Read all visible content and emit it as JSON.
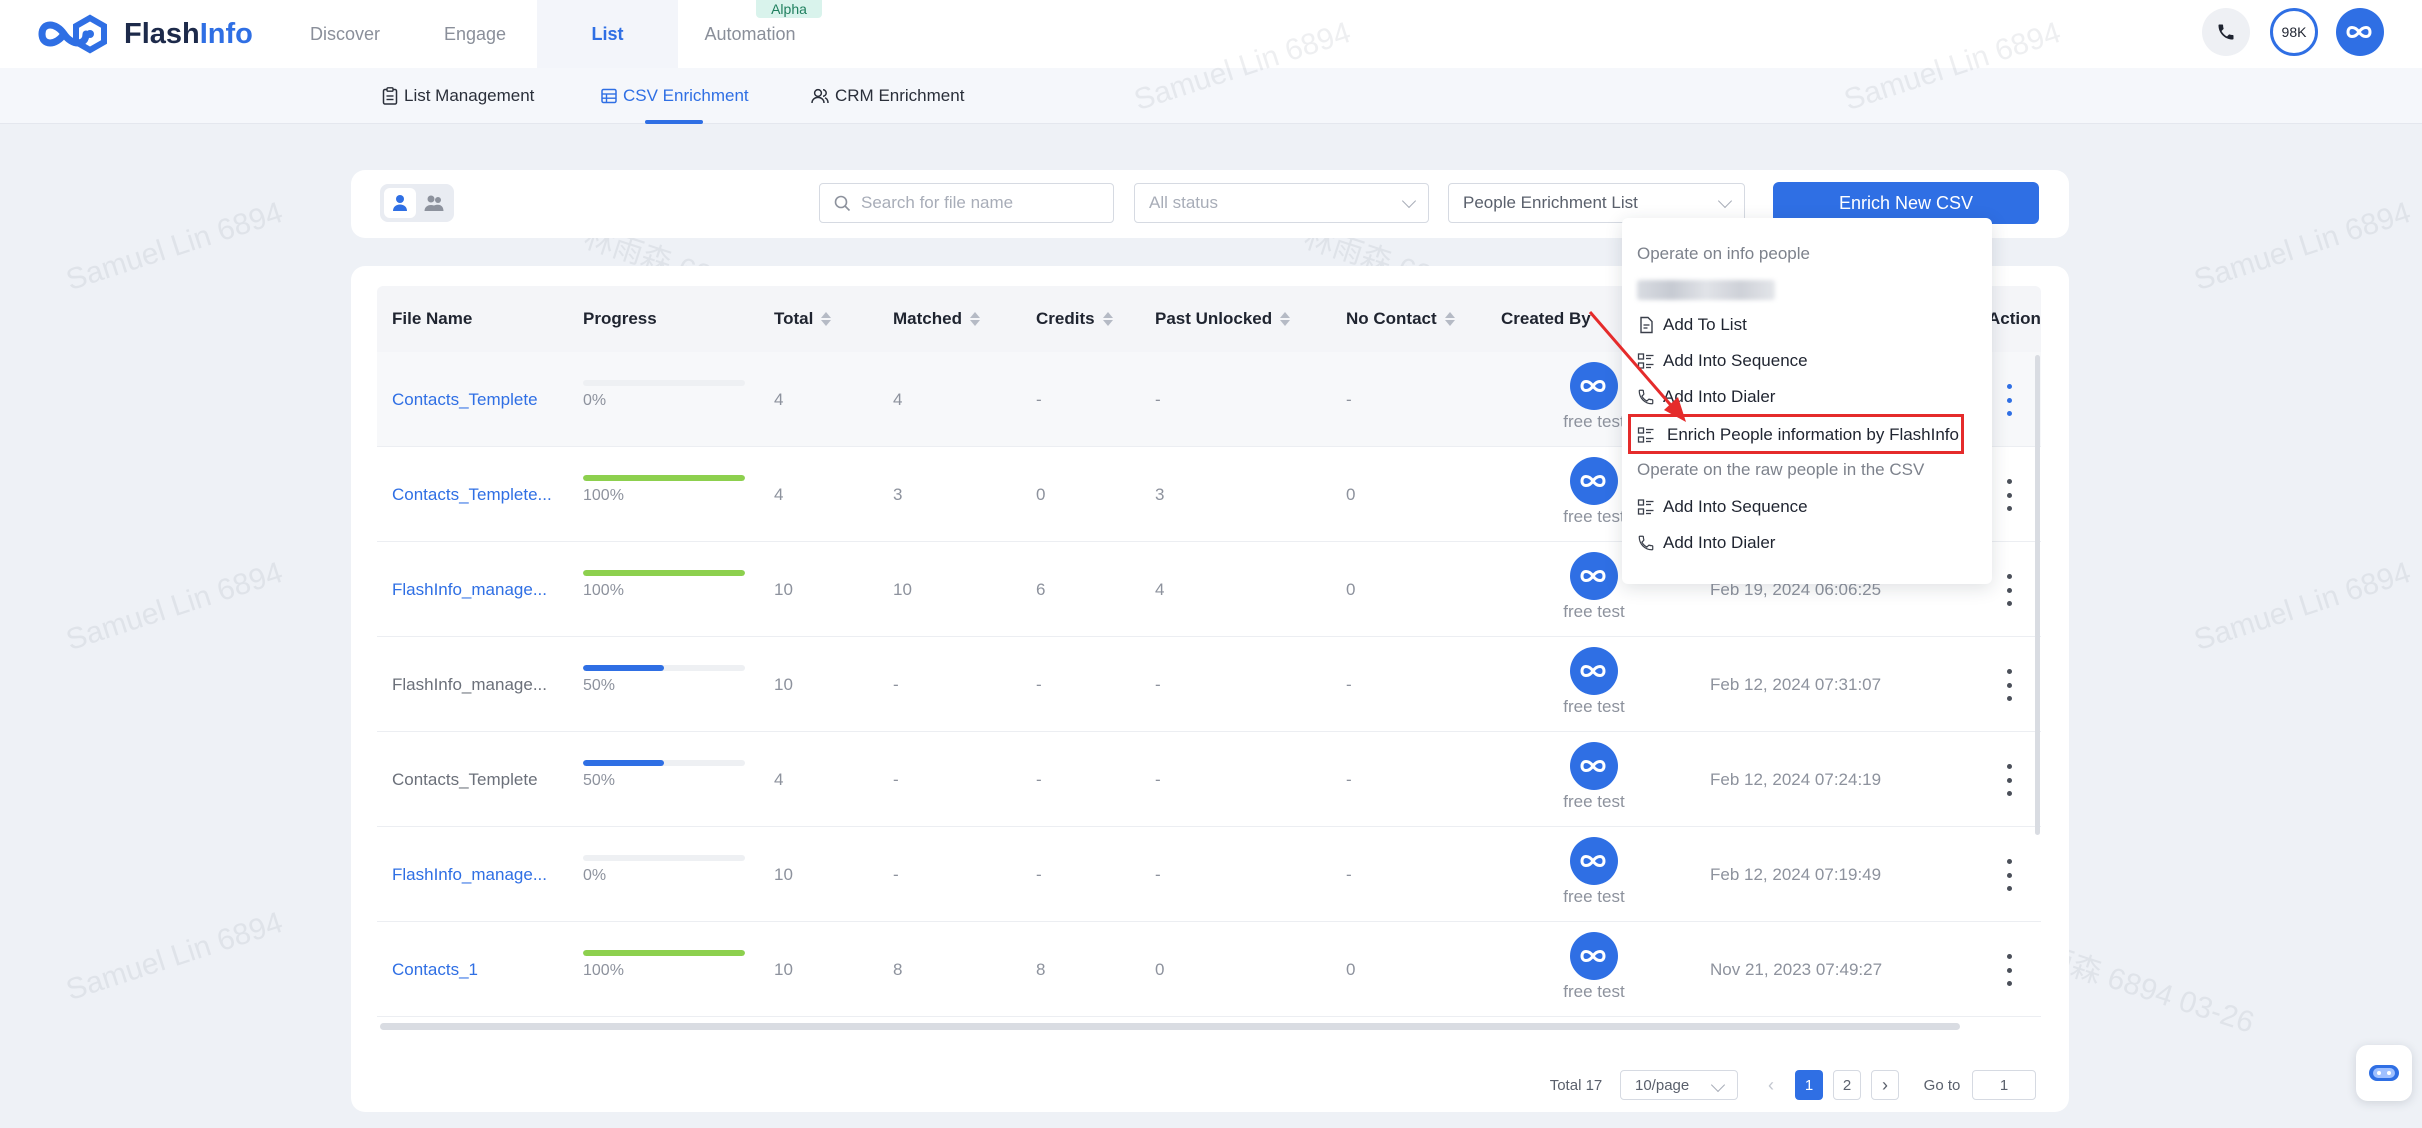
{
  "brand": {
    "name_part1": "Flash",
    "name_part2": "Info",
    "accent": "#2f6fe4"
  },
  "nav": {
    "tabs": [
      {
        "label": "Discover"
      },
      {
        "label": "Engage"
      },
      {
        "label": "List"
      },
      {
        "label": "Automation"
      }
    ],
    "badge": "Alpha",
    "credits": "98K",
    "phone_icon": "phone-icon",
    "profile_icon": "flashinfo-logo-icon"
  },
  "subnav": {
    "tabs": [
      {
        "label": "List Management",
        "icon": "clipboard-icon"
      },
      {
        "label": "CSV Enrichment",
        "icon": "table-icon"
      },
      {
        "label": "CRM Enrichment",
        "icon": "users-icon"
      }
    ]
  },
  "toolbar": {
    "search_placeholder": "Search for file name",
    "status_placeholder": "All status",
    "list_type": "People Enrichment List",
    "enrich_button": "Enrich New CSV"
  },
  "table": {
    "headers": {
      "file_name": "File Name",
      "progress": "Progress",
      "total": "Total",
      "matched": "Matched",
      "credits": "Credits",
      "past_unlocked": "Past Unlocked",
      "no_contact": "No Contact",
      "created_by": "Created By",
      "action": "Action"
    },
    "rows": [
      {
        "file": "Contacts_Templete",
        "progress": "0%",
        "progress_value": 0,
        "total": "4",
        "matched": "4",
        "credits": "-",
        "past": "-",
        "nocontact": "-",
        "creator": "free test",
        "date": ""
      },
      {
        "file": "Contacts_Templete...",
        "progress": "100%",
        "progress_value": 100,
        "total": "4",
        "matched": "3",
        "credits": "0",
        "past": "3",
        "nocontact": "0",
        "creator": "free test",
        "date": ""
      },
      {
        "file": "FlashInfo_manage...",
        "progress": "100%",
        "progress_value": 100,
        "total": "10",
        "matched": "10",
        "credits": "6",
        "past": "4",
        "nocontact": "0",
        "creator": "free test",
        "date": "Feb 19, 2024 06:06:25"
      },
      {
        "file": "FlashInfo_manage...",
        "progress": "50%",
        "progress_value": 50,
        "total": "10",
        "matched": "-",
        "credits": "-",
        "past": "-",
        "nocontact": "-",
        "creator": "free test",
        "date": "Feb 12, 2024 07:31:07"
      },
      {
        "file": "Contacts_Templete",
        "progress": "50%",
        "progress_value": 50,
        "total": "4",
        "matched": "-",
        "credits": "-",
        "past": "-",
        "nocontact": "-",
        "creator": "free test",
        "date": "Feb 12, 2024 07:24:19"
      },
      {
        "file": "FlashInfo_manage...",
        "progress": "0%",
        "progress_value": 0,
        "total": "10",
        "matched": "-",
        "credits": "-",
        "past": "-",
        "nocontact": "-",
        "creator": "free test",
        "date": "Feb 12, 2024 07:19:49"
      },
      {
        "file": "Contacts_1",
        "progress": "100%",
        "progress_value": 100,
        "total": "10",
        "matched": "8",
        "credits": "8",
        "past": "0",
        "nocontact": "0",
        "creator": "free test",
        "date": "Nov 21, 2023 07:49:27"
      }
    ]
  },
  "colors": {
    "green": "#8dd04e",
    "blue": "#2f6fe4",
    "highlight": "#e52b2b"
  },
  "pagination": {
    "total": "Total 17",
    "page_size": "10/page",
    "pages": [
      "1",
      "2"
    ],
    "goto_label": "Go to",
    "goto_value": "1"
  },
  "menu": {
    "header1": "Operate on info people",
    "items1": [
      {
        "label": "Add To List",
        "icon": "document-icon"
      },
      {
        "label": "Add Into Sequence",
        "icon": "sequence-icon"
      },
      {
        "label": "Add Into Dialer",
        "icon": "phone-icon"
      },
      {
        "label": "Enrich People information by FlashInfo",
        "icon": "sequence-icon"
      }
    ],
    "header2": "Operate on the raw people in the CSV",
    "items2": [
      {
        "label": "Add Into Sequence",
        "icon": "sequence-icon"
      },
      {
        "label": "Add Into Dialer",
        "icon": "phone-icon"
      }
    ]
  },
  "watermarks": [
    "Samuel Lin 6894",
    "林雨森 6894 03-26"
  ]
}
